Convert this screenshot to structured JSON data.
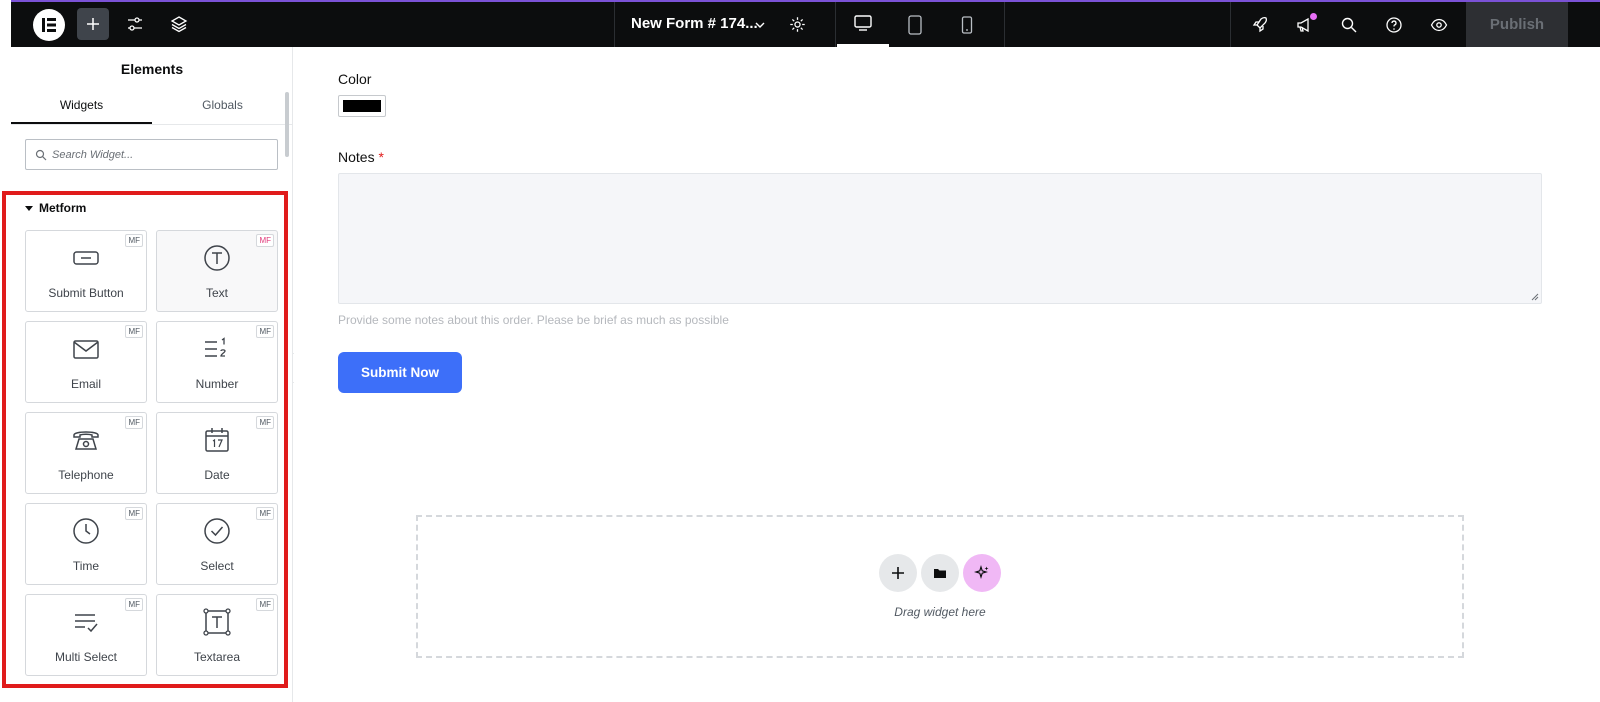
{
  "topbar": {
    "document_title": "New Form # 174...",
    "publish_label": "Publish"
  },
  "sidebar": {
    "title": "Elements",
    "tabs": [
      {
        "label": "Widgets"
      },
      {
        "label": "Globals"
      }
    ],
    "search_placeholder": "Search Widget...",
    "category": "Metform",
    "widgets": [
      {
        "label": "Submit Button",
        "badge": "MF"
      },
      {
        "label": "Text",
        "badge": "MF"
      },
      {
        "label": "Email",
        "badge": "MF"
      },
      {
        "label": "Number",
        "badge": "MF"
      },
      {
        "label": "Telephone",
        "badge": "MF"
      },
      {
        "label": "Date",
        "badge": "MF"
      },
      {
        "label": "Time",
        "badge": "MF"
      },
      {
        "label": "Select",
        "badge": "MF"
      },
      {
        "label": "Multi Select",
        "badge": "MF"
      },
      {
        "label": "Textarea",
        "badge": "MF"
      }
    ]
  },
  "form": {
    "color_label": "Color",
    "color_value": "#000000",
    "notes_label": "Notes",
    "notes_required": "*",
    "notes_help": "Provide some notes about this order. Please be brief as much as possible",
    "submit_label": "Submit Now"
  },
  "dropzone": {
    "text": "Drag widget here"
  },
  "colors": {
    "accent": "#3d6ff9",
    "highlight": "#e01b1b",
    "topbar": "#0c0d0e"
  }
}
